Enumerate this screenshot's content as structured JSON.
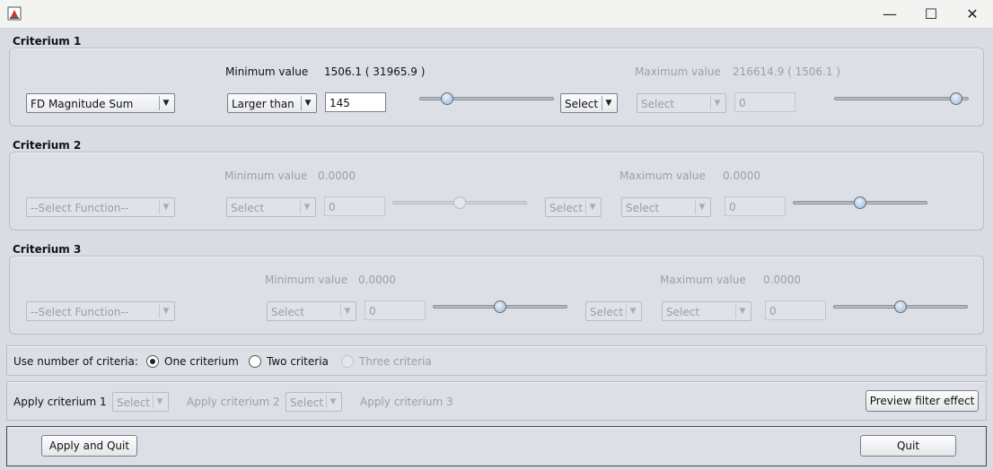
{
  "window": {
    "minimize_glyph": "—",
    "maximize_glyph": "☐",
    "close_glyph": "✕"
  },
  "criteria": [
    {
      "title": "Criterium 1",
      "function": "FD Magnitude Sum",
      "min_label": "Minimum value",
      "min_value": "1506.1 ( 31965.9 )",
      "max_label": "Maximum value",
      "max_value": "216614.9 ( 1506.1 )",
      "min_op": "Larger than",
      "min_input": "145",
      "min_slider_pos": 0.18,
      "logic_select": "Select",
      "max_op": "Select",
      "max_input": "0",
      "max_slider_pos": 0.95
    },
    {
      "title": "Criterium 2",
      "function": "--Select Function--",
      "min_label": "Minimum value",
      "min_value": "0.0000",
      "max_label": "Maximum value",
      "max_value": "0.0000",
      "min_op": "Select",
      "min_input": "0",
      "min_slider_pos": 0.5,
      "logic_select": "Select",
      "max_op": "Select",
      "max_input": "0",
      "max_slider_pos": 0.5
    },
    {
      "title": "Criterium 3",
      "function": "--Select Function--",
      "min_label": "Minimum value",
      "min_value": "0.0000",
      "max_label": "Maximum value",
      "max_value": "0.0000",
      "min_op": "Select",
      "min_input": "0",
      "min_slider_pos": 0.5,
      "logic_select": "Select",
      "max_op": "Select",
      "max_input": "0",
      "max_slider_pos": 0.5
    }
  ],
  "num_criteria": {
    "label": "Use number of criteria:",
    "options": [
      "One criterium",
      "Two criteria",
      "Three criteria"
    ],
    "selected": "One criterium"
  },
  "apply": {
    "label1": "Apply criterium 1",
    "select1": "Select",
    "label2": "Apply criterium 2",
    "select2": "Select",
    "label3": "Apply criterium 3",
    "preview_button": "Preview filter effect"
  },
  "footer": {
    "apply_quit_button": "Apply and Quit",
    "quit_button": "Quit"
  }
}
